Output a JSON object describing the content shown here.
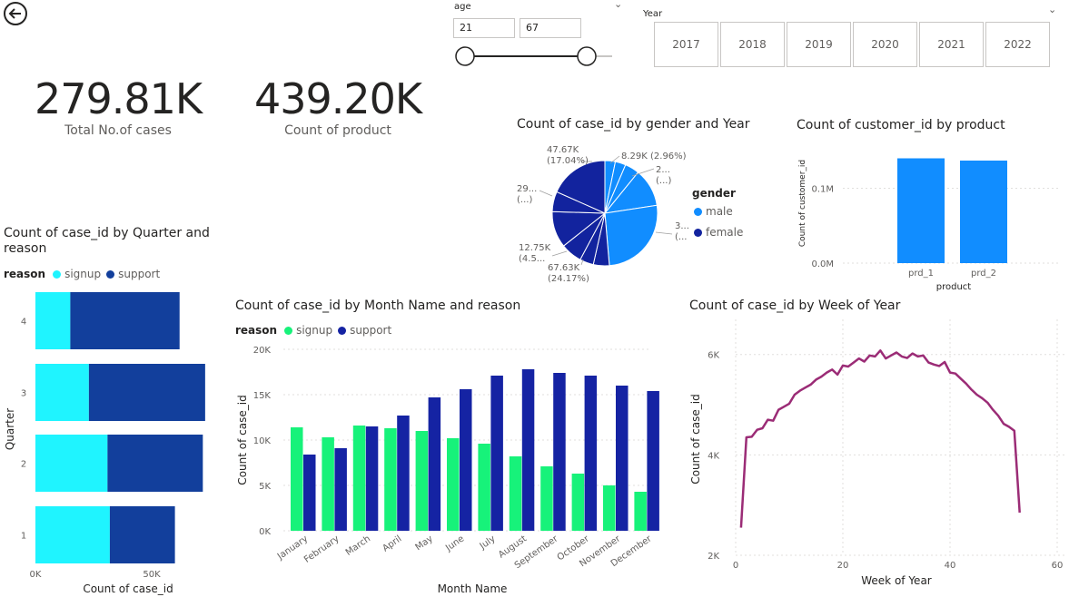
{
  "kpis": [
    {
      "value": "279.81K",
      "label": "Total No.of cases"
    },
    {
      "value": "439.20K",
      "label": "Count of product"
    }
  ],
  "age_slicer": {
    "label": "age",
    "min": "21",
    "max": "67"
  },
  "year_slicer": {
    "label": "Year",
    "years": [
      "2017",
      "2018",
      "2019",
      "2020",
      "2021",
      "2022"
    ]
  },
  "colors": {
    "signup_hbar": "#1ff4ff",
    "support_hbar": "#123f9c",
    "signup": "#17f27a",
    "support": "#1523a3",
    "male": "#118dff",
    "female": "#12239e",
    "line": "#9b2c76"
  },
  "chart_data": [
    {
      "id": "gender_pie",
      "type": "pie",
      "title": "Count of case_id by gender and Year",
      "legend_title": "gender",
      "legend": [
        "male",
        "female"
      ],
      "labels": [
        {
          "text": "47.67K",
          "sub": "(17.04%)"
        },
        {
          "text": "8.29K (2.96%)",
          "sub": ""
        },
        {
          "text": "2...",
          "sub": "(...)"
        },
        {
          "text": "29...",
          "sub": "(...)"
        },
        {
          "text": "3...",
          "sub": "(..."
        },
        {
          "text": "12.75K",
          "sub": "(4.5..."
        },
        {
          "text": "67.63K",
          "sub": "(24.17%)"
        }
      ],
      "slices": [
        {
          "gender": "male",
          "value": 8.29
        },
        {
          "gender": "male",
          "value": 8.4
        },
        {
          "gender": "male",
          "value": 11.5
        },
        {
          "gender": "male",
          "value": 30.5
        },
        {
          "gender": "male",
          "value": 67.63
        },
        {
          "gender": "female",
          "value": 12.75
        },
        {
          "gender": "female",
          "value": 11.0
        },
        {
          "gender": "female",
          "value": 17.0
        },
        {
          "gender": "female",
          "value": 29.0
        },
        {
          "gender": "female",
          "value": 16.0
        },
        {
          "gender": "female",
          "value": 47.67
        }
      ]
    },
    {
      "id": "product_bar",
      "type": "bar",
      "title": "Count of customer_id by product",
      "xlabel": "product",
      "ylabel": "Count of customer_id",
      "categories": [
        "prd_1",
        "prd_2"
      ],
      "values": [
        140000,
        137000
      ],
      "ylim": [
        0,
        160000
      ],
      "ytick_values": [
        0,
        100000
      ],
      "ytick_labels": [
        "0.0M",
        "0.1M"
      ]
    },
    {
      "id": "quarter_hbar",
      "type": "bar",
      "orientation": "horizontal",
      "stacked": true,
      "title": "Count of case_id by Quarter and reason",
      "legend_title": "reason",
      "xlabel": "Count of case_id",
      "ylabel": "Quarter",
      "categories": [
        "4",
        "3",
        "2",
        "1"
      ],
      "series": [
        {
          "name": "signup",
          "values": [
            15000,
            23000,
            31000,
            32000
          ]
        },
        {
          "name": "support",
          "values": [
            47000,
            50000,
            41000,
            28000
          ]
        }
      ],
      "xlim": [
        0,
        75000
      ],
      "xtick_values": [
        0,
        50000
      ],
      "xtick_labels": [
        "0K",
        "50K"
      ]
    },
    {
      "id": "month_bar",
      "type": "bar",
      "title": "Count of case_id by Month Name and reason",
      "legend_title": "reason",
      "xlabel": "Month Name",
      "ylabel": "Count of case_id",
      "categories": [
        "January",
        "February",
        "March",
        "April",
        "May",
        "June",
        "July",
        "August",
        "September",
        "October",
        "November",
        "December"
      ],
      "series": [
        {
          "name": "signup",
          "values": [
            11400,
            10300,
            11600,
            11300,
            11000,
            10200,
            9600,
            8200,
            7100,
            6300,
            5000,
            4300
          ]
        },
        {
          "name": "support",
          "values": [
            8400,
            9100,
            11500,
            12700,
            14700,
            15600,
            17100,
            17800,
            17400,
            17100,
            16000,
            15400
          ]
        }
      ],
      "ylim": [
        0,
        20000
      ],
      "ytick_values": [
        0,
        5000,
        10000,
        15000,
        20000
      ],
      "ytick_labels": [
        "0K",
        "5K",
        "10K",
        "15K",
        "20K"
      ]
    },
    {
      "id": "week_line",
      "type": "line",
      "title": "Count of case_id by Week of Year",
      "xlabel": "Week of Year",
      "ylabel": "Count of case_id",
      "xlim": [
        0,
        60
      ],
      "ylim": [
        2000,
        6700
      ],
      "xtick_values": [
        0,
        20,
        40,
        60
      ],
      "xtick_labels": [
        "0",
        "20",
        "40",
        "60"
      ],
      "ytick_values": [
        2000,
        4000,
        6000
      ],
      "ytick_labels": [
        "2K",
        "4K",
        "6K"
      ],
      "x": [
        1,
        2,
        3,
        4,
        5,
        6,
        7,
        8,
        9,
        10,
        11,
        12,
        13,
        14,
        15,
        16,
        17,
        18,
        19,
        20,
        21,
        22,
        23,
        24,
        25,
        26,
        27,
        28,
        29,
        30,
        31,
        32,
        33,
        34,
        35,
        36,
        37,
        38,
        39,
        40,
        41,
        42,
        43,
        44,
        45,
        46,
        47,
        48,
        49,
        50,
        51,
        52,
        53
      ],
      "y": [
        2550,
        4350,
        4360,
        4500,
        4530,
        4700,
        4680,
        4900,
        4960,
        5020,
        5200,
        5280,
        5340,
        5400,
        5500,
        5560,
        5640,
        5700,
        5600,
        5780,
        5760,
        5840,
        5920,
        5860,
        5980,
        5960,
        6080,
        5920,
        5980,
        6040,
        5960,
        5930,
        6020,
        5960,
        5980,
        5840,
        5800,
        5770,
        5850,
        5640,
        5620,
        5520,
        5420,
        5300,
        5200,
        5130,
        5040,
        4900,
        4780,
        4620,
        4560,
        4480,
        2850
      ]
    }
  ]
}
